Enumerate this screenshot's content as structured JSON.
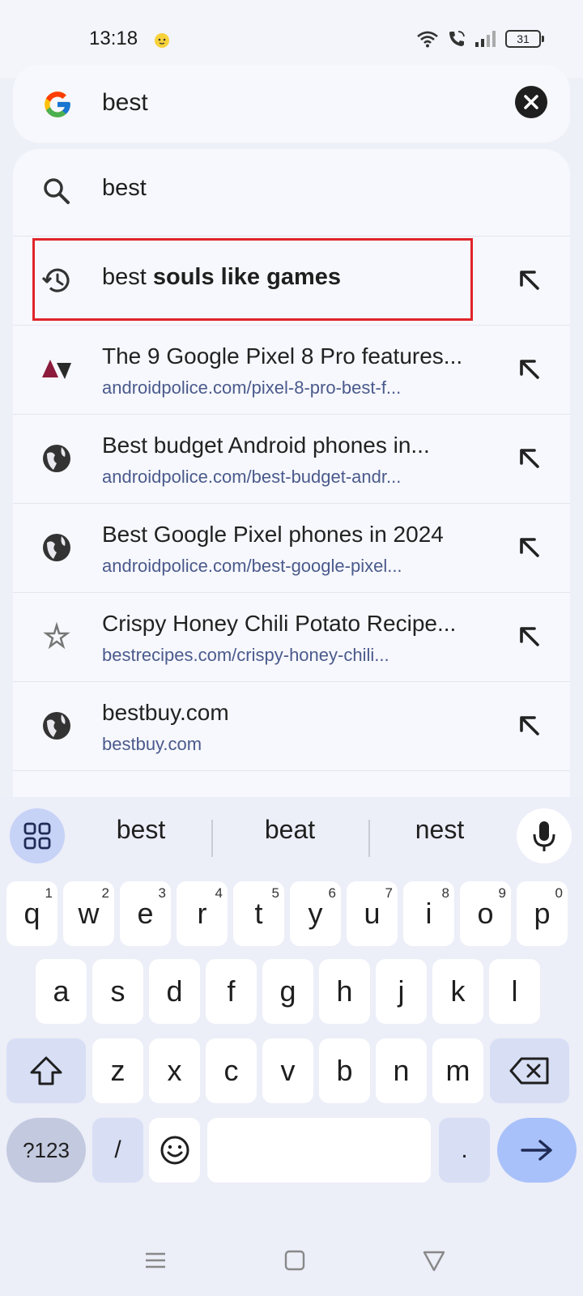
{
  "status_bar": {
    "time": "13:18",
    "battery": "31"
  },
  "search": {
    "query": "best"
  },
  "suggestions": [
    {
      "type": "query",
      "icon": "search-icon",
      "text_plain": "best",
      "text_bold": ""
    },
    {
      "type": "history",
      "icon": "history-icon",
      "text_plain": "best ",
      "text_bold": "souls like games"
    },
    {
      "type": "site",
      "icon": "site-logo-icon",
      "title": "The 9 Google Pixel 8 Pro features...",
      "url": "androidpolice.com/pixel-8-pro-best-f..."
    },
    {
      "type": "site",
      "icon": "globe-icon",
      "title": "Best budget Android phones in...",
      "url": "androidpolice.com/best-budget-andr..."
    },
    {
      "type": "site",
      "icon": "globe-icon",
      "title": "Best Google Pixel phones in 2024",
      "url": "androidpolice.com/best-google-pixel..."
    },
    {
      "type": "site",
      "icon": "star-icon",
      "title": "Crispy Honey Chili Potato Recipe...",
      "url": "bestrecipes.com/crispy-honey-chili..."
    },
    {
      "type": "site",
      "icon": "globe-icon",
      "title": "bestbuy.com",
      "url": "bestbuy.com"
    }
  ],
  "keyboard": {
    "suggestions": [
      "best",
      "beat",
      "nest"
    ],
    "row1": [
      {
        "k": "q",
        "s": "1"
      },
      {
        "k": "w",
        "s": "2"
      },
      {
        "k": "e",
        "s": "3"
      },
      {
        "k": "r",
        "s": "4"
      },
      {
        "k": "t",
        "s": "5"
      },
      {
        "k": "y",
        "s": "6"
      },
      {
        "k": "u",
        "s": "7"
      },
      {
        "k": "i",
        "s": "8"
      },
      {
        "k": "o",
        "s": "9"
      },
      {
        "k": "p",
        "s": "0"
      }
    ],
    "row2": [
      "a",
      "s",
      "d",
      "f",
      "g",
      "h",
      "j",
      "k",
      "l"
    ],
    "row3": [
      "z",
      "x",
      "c",
      "v",
      "b",
      "n",
      "m"
    ],
    "symbols_label": "?123",
    "slash": "/",
    "period": "."
  }
}
